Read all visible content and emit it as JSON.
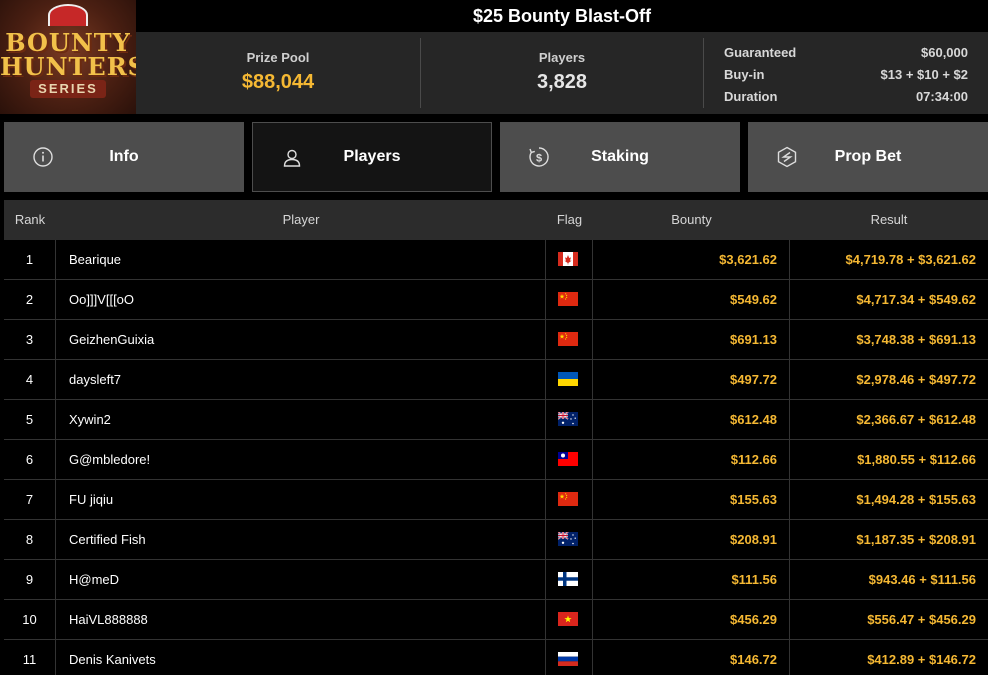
{
  "logo": {
    "line1": "BOUNTY",
    "line2": "HUNTERS",
    "line3": "SERIES"
  },
  "title": "$25 Bounty Blast-Off",
  "stats": {
    "prize_pool_label": "Prize Pool",
    "prize_pool_value": "$88,044",
    "players_label": "Players",
    "players_value": "3,828",
    "guaranteed_label": "Guaranteed",
    "guaranteed_value": "$60,000",
    "buyin_label": "Buy-in",
    "buyin_value": "$13 + $10 + $2",
    "duration_label": "Duration",
    "duration_value": "07:34:00"
  },
  "colors": {
    "accent": "#f5b833",
    "tab_inactive": "#4d4d4d",
    "tab_active": "#141414"
  },
  "tabs": [
    {
      "label": "Info",
      "icon": "info-icon"
    },
    {
      "label": "Players",
      "icon": "user-icon",
      "active": true
    },
    {
      "label": "Staking",
      "icon": "staking-icon"
    },
    {
      "label": "Prop Bet",
      "icon": "prop-bet-icon"
    }
  ],
  "table": {
    "headers": {
      "rank": "Rank",
      "player": "Player",
      "flag": "Flag",
      "bounty": "Bounty",
      "result": "Result"
    },
    "rows": [
      {
        "rank": "1",
        "player": "Bearique",
        "flag": "canada",
        "bounty": "$3,621.62",
        "result": "$4,719.78 + $3,621.62"
      },
      {
        "rank": "2",
        "player": "Oo]]]V[[[oO",
        "flag": "china",
        "bounty": "$549.62",
        "result": "$4,717.34 + $549.62"
      },
      {
        "rank": "3",
        "player": "GeizhenGuixia",
        "flag": "china",
        "bounty": "$691.13",
        "result": "$3,748.38 + $691.13"
      },
      {
        "rank": "4",
        "player": "daysleft7",
        "flag": "ukraine",
        "bounty": "$497.72",
        "result": "$2,978.46 + $497.72"
      },
      {
        "rank": "5",
        "player": "Xywin2",
        "flag": "australia",
        "bounty": "$612.48",
        "result": "$2,366.67 + $612.48"
      },
      {
        "rank": "6",
        "player": "G@mbledore!",
        "flag": "taiwan",
        "bounty": "$112.66",
        "result": "$1,880.55 + $112.66"
      },
      {
        "rank": "7",
        "player": "FU jiqiu",
        "flag": "china",
        "bounty": "$155.63",
        "result": "$1,494.28 + $155.63"
      },
      {
        "rank": "8",
        "player": "Certified Fish",
        "flag": "australia",
        "bounty": "$208.91",
        "result": "$1,187.35 + $208.91"
      },
      {
        "rank": "9",
        "player": "H@meD",
        "flag": "finland",
        "bounty": "$111.56",
        "result": "$943.46 + $111.56"
      },
      {
        "rank": "10",
        "player": "HaiVL888888",
        "flag": "vietnam",
        "bounty": "$456.29",
        "result": "$556.47 + $456.29"
      },
      {
        "rank": "11",
        "player": "Denis Kanivets",
        "flag": "russia",
        "bounty": "$146.72",
        "result": "$412.89 + $146.72"
      }
    ]
  }
}
